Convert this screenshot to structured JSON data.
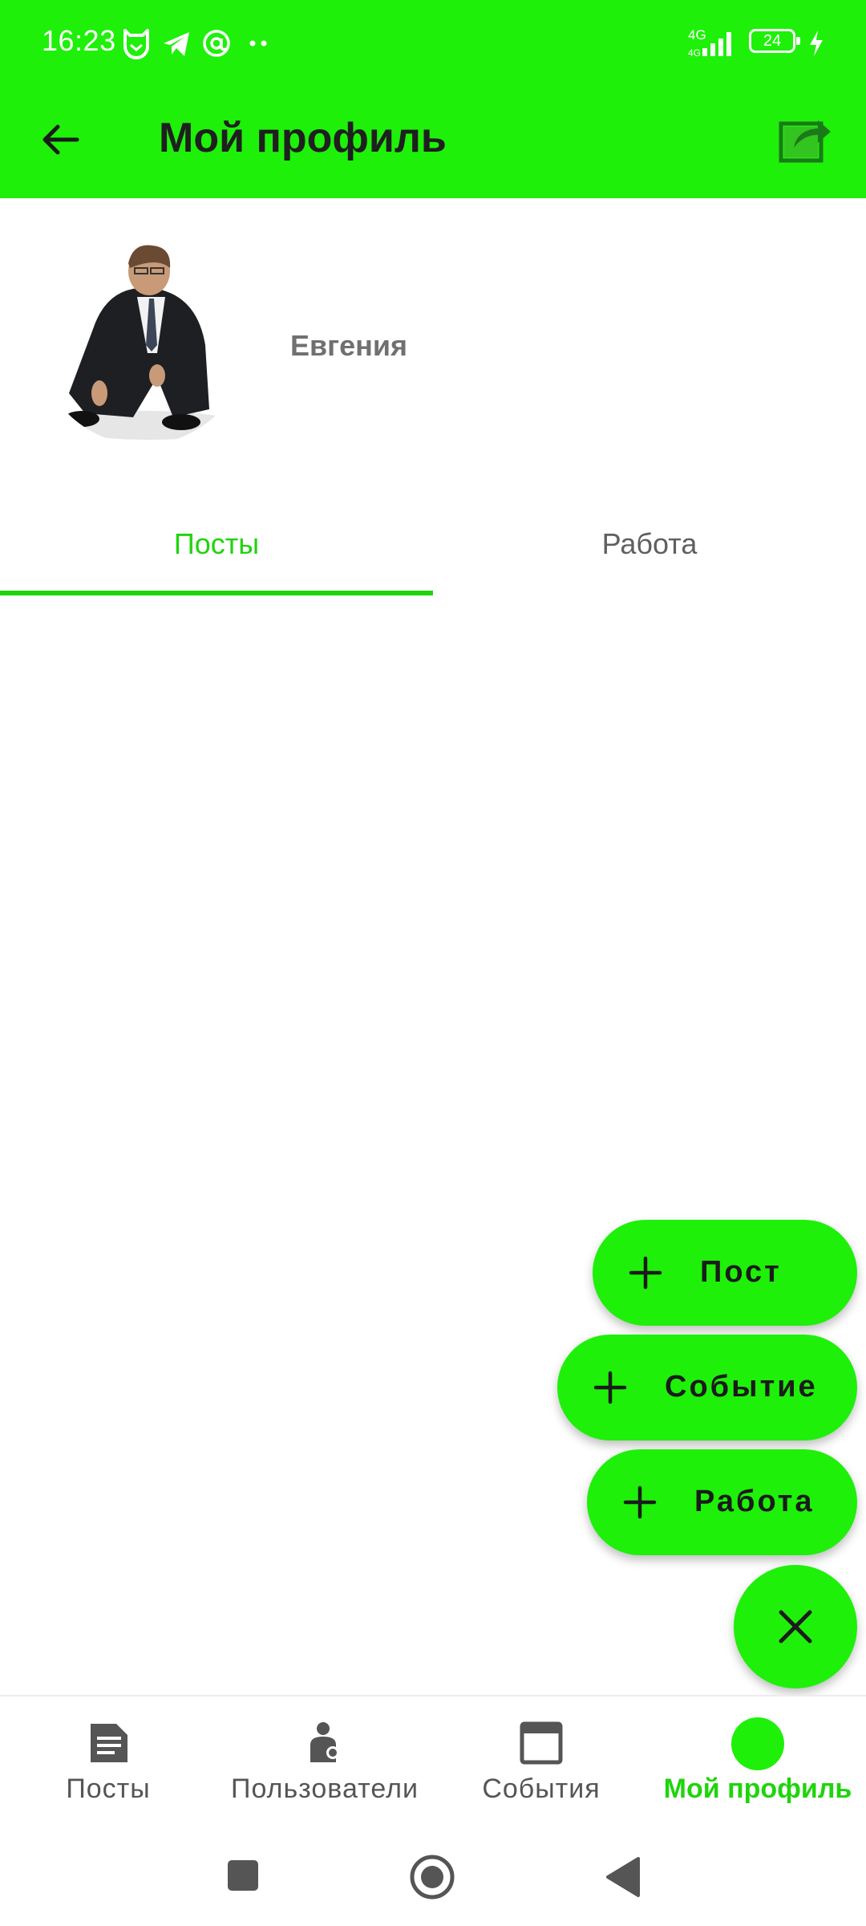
{
  "status_bar": {
    "time": "16:23",
    "network": "4G",
    "battery": "24"
  },
  "app_bar": {
    "title": "Мой профиль"
  },
  "profile": {
    "name": "Евгения"
  },
  "tabs": [
    {
      "label": "Посты",
      "active": true
    },
    {
      "label": "Работа",
      "active": false
    }
  ],
  "fab_menu": [
    {
      "label": "Пост"
    },
    {
      "label": "Событие"
    },
    {
      "label": "Работа"
    }
  ],
  "bottom_nav": [
    {
      "label": "Посты",
      "icon": "document-icon"
    },
    {
      "label": "Пользователи",
      "icon": "user-icon"
    },
    {
      "label": "События",
      "icon": "calendar-window-icon"
    },
    {
      "label": "Мой профиль",
      "icon": "profile-dot-icon",
      "active": true
    }
  ],
  "colors": {
    "accent": "#1ef00a",
    "accent_text": "#1fd40c",
    "title_text": "#1f1f1f",
    "muted_text": "#707070"
  }
}
